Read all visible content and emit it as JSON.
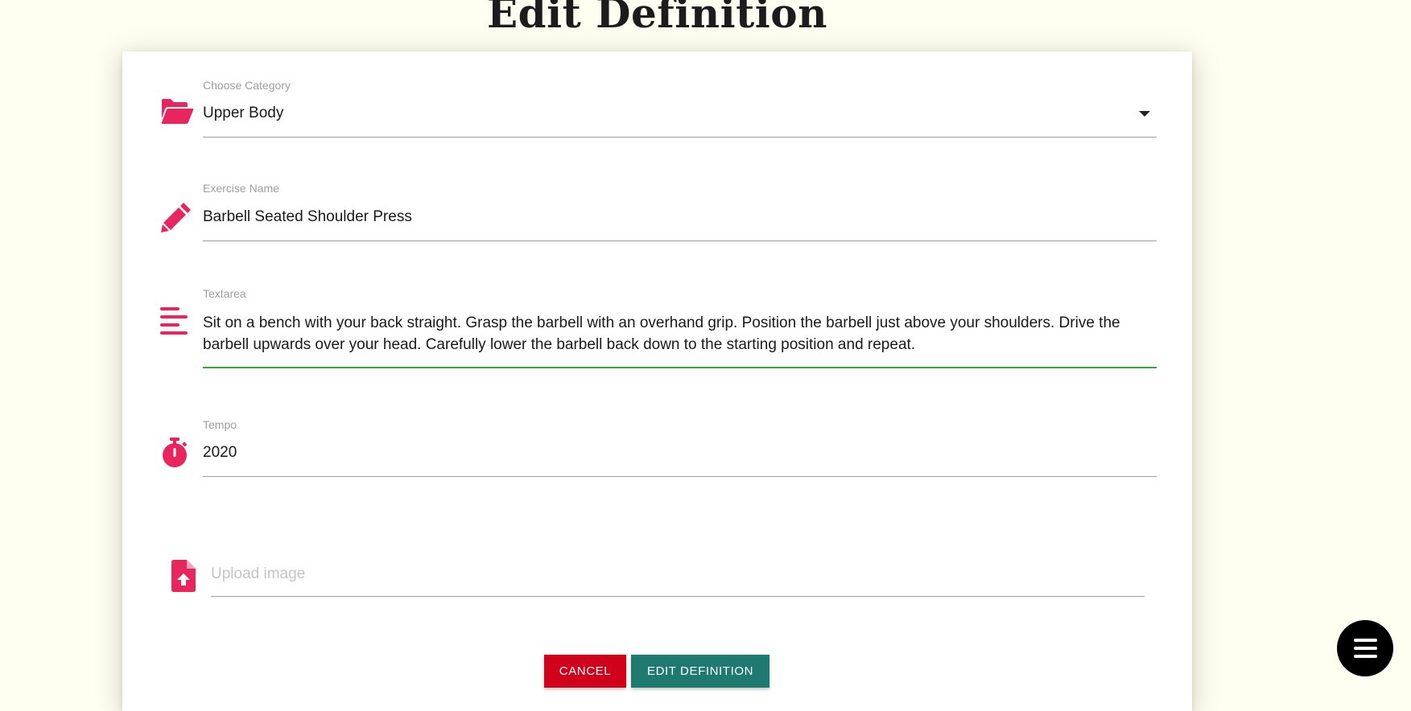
{
  "page": {
    "title": "Edit Definition"
  },
  "form": {
    "category": {
      "label": "Choose Category",
      "value": "Upper Body",
      "icon": "folder-open-icon"
    },
    "exercise_name": {
      "label": "Exercise Name",
      "value": "Barbell Seated Shoulder Press",
      "icon": "pencil-icon"
    },
    "description": {
      "label": "Textarea",
      "value": "Sit on a bench with your back straight. Grasp the barbell with an overhand grip. Position the barbell just above your shoulders. Drive the barbell upwards over your head. Carefully lower the barbell back down to the starting position and repeat.",
      "icon": "align-left-icon"
    },
    "tempo": {
      "label": "Tempo",
      "value": "2020",
      "icon": "stopwatch-icon"
    },
    "upload": {
      "placeholder": "Upload image",
      "icon": "file-upload-icon"
    }
  },
  "actions": {
    "cancel_label": "CANCEL",
    "submit_label": "EDIT DEFINITION"
  },
  "fab": {
    "icon": "menu-icon"
  },
  "colors": {
    "background": "#fefef1",
    "accent_icon": "#e8255f",
    "focus_underline": "#3aa23a",
    "cancel": "#d0021b",
    "submit": "#1e7a70",
    "fab": "#000000"
  }
}
